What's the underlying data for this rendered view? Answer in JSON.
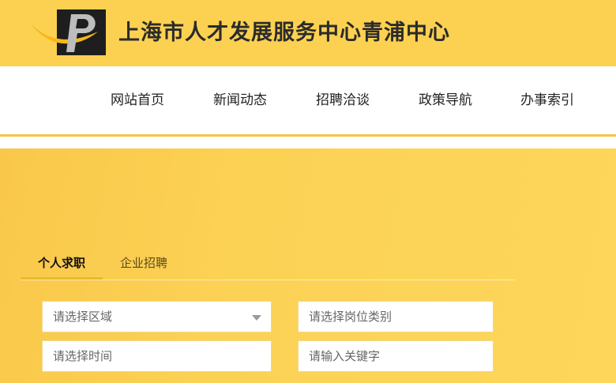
{
  "header": {
    "site_title": "上海市人才发展服务中心青浦中心",
    "logo_icon": "logo-icon"
  },
  "nav": {
    "items": [
      {
        "label": "网站首页"
      },
      {
        "label": "新闻动态"
      },
      {
        "label": "招聘洽谈"
      },
      {
        "label": "政策导航"
      },
      {
        "label": "办事索引"
      }
    ]
  },
  "search": {
    "tabs": [
      {
        "label": "个人求职",
        "active": true
      },
      {
        "label": "企业招聘",
        "active": false
      }
    ],
    "fields": {
      "region": {
        "placeholder": "请选择区域",
        "icon": "chevron-down-icon"
      },
      "job_category": {
        "placeholder": "请选择岗位类别"
      },
      "time": {
        "placeholder": "请选择时间"
      },
      "keyword": {
        "placeholder": "请输入关键字"
      }
    }
  },
  "colors": {
    "header_bg": "#fcd152",
    "accent": "#e8b92f",
    "hero_bg": "#fdd65a"
  }
}
